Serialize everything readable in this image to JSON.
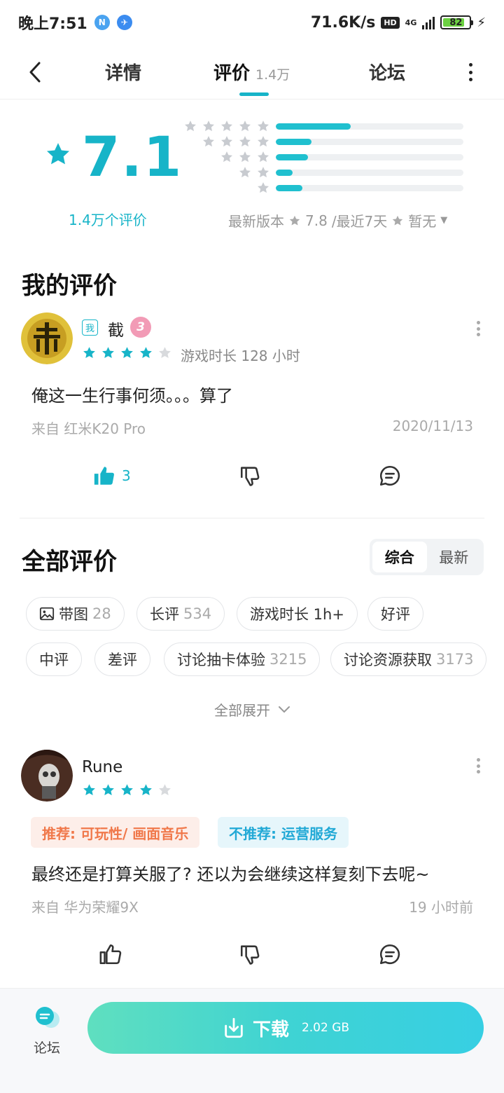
{
  "status_bar": {
    "time": "晚上7:51",
    "net_speed": "71.6K/s",
    "hd": "HD",
    "network": "4G",
    "battery": "82"
  },
  "nav": {
    "tab_detail": "详情",
    "tab_review": "评价",
    "tab_review_count": "1.4万",
    "tab_forum": "论坛"
  },
  "rating": {
    "score": "7.1",
    "count_label": "1.4万个评价",
    "distribution_fraction": [
      0.4,
      0.19,
      0.17,
      0.09,
      0.14
    ],
    "latest_version_label": "最新版本",
    "latest_version_score": "7.8",
    "recent_label": "/最近7天",
    "recent_score": "暂无"
  },
  "my_review": {
    "section_title": "我的评价",
    "me_badge": "我",
    "username": "截",
    "level": "3",
    "stars": 4,
    "playtime": "游戏时长 128 小时",
    "text": "俺这一生行事何须。。。算了",
    "from": "来自 红米K20 Pro",
    "date": "2020/11/13",
    "likes": "3"
  },
  "all_reviews": {
    "section_title": "全部评价",
    "sort_options": [
      "综合",
      "最新"
    ],
    "chips": [
      {
        "label": "带图",
        "num": "28"
      },
      {
        "label": "长评",
        "num": "534"
      },
      {
        "label": "游戏时长 1h+",
        "num": ""
      },
      {
        "label": "好评",
        "num": ""
      },
      {
        "label": "中评",
        "num": ""
      },
      {
        "label": "差评",
        "num": ""
      },
      {
        "label": "讨论抽卡体验",
        "num": "3215"
      },
      {
        "label": "讨论资源获取",
        "num": "3173"
      }
    ],
    "expand_label": "全部展开"
  },
  "review_rune": {
    "username": "Rune",
    "stars": 4,
    "tag_recommend": "推荐: 可玩性/ 画面音乐",
    "tag_not_recommend": "不推荐: 运营服务",
    "text": "最终还是打算关服了? 还以为会继续这样复刻下去呢~",
    "from": "来自 华为荣耀9X",
    "time": "19 小时前"
  },
  "bottom": {
    "forum_label": "论坛",
    "download_label": "下载",
    "download_size": "2.02 GB"
  },
  "colors": {
    "accent": "#17b4c8",
    "star_active": "#17b4c8",
    "star_inactive": "#d8dadd",
    "recommend": "#f0784a",
    "not_recommend": "#21a9d6"
  }
}
